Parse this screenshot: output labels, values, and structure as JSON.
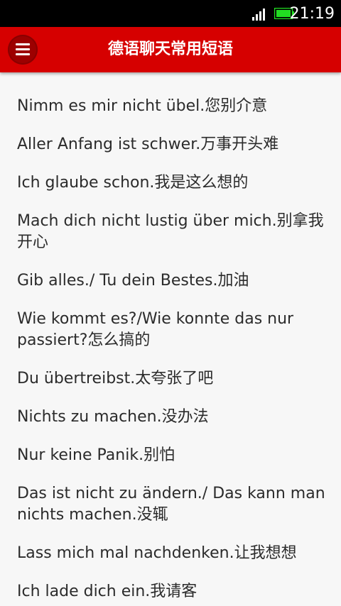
{
  "status_bar": {
    "time": "21:19",
    "signal_icon": "signal-bars-icon",
    "battery_icon": "battery-charging-icon"
  },
  "app_bar": {
    "menu_icon": "hamburger-menu-icon",
    "title": "德语聊天常用短语"
  },
  "phrases": [
    "Nimm es mir nicht übel.您别介意",
    "Aller Anfang ist schwer.万事开头难",
    "Ich glaube schon.我是这么想的",
    "Mach dich nicht lustig über mich.别拿我开心",
    "Gib alles./ Tu dein Bestes.加油",
    "Wie kommt es?/Wie konnte das nur passiert?怎么搞的",
    "Du übertreibst.太夸张了吧",
    "Nichts zu machen.没办法",
    "Nur keine Panik.别怕",
    "Das ist nicht zu ändern./ Das kann man nichts machen.没辄",
    "Lass mich mal nachdenken.让我想想",
    "Ich lade dich ein.我请客"
  ],
  "colors": {
    "app_bar": "#d60000",
    "menu_button": "#9d0000",
    "background": "#f7f7f7",
    "text": "#2b2b2b",
    "battery": "#22dd22"
  }
}
